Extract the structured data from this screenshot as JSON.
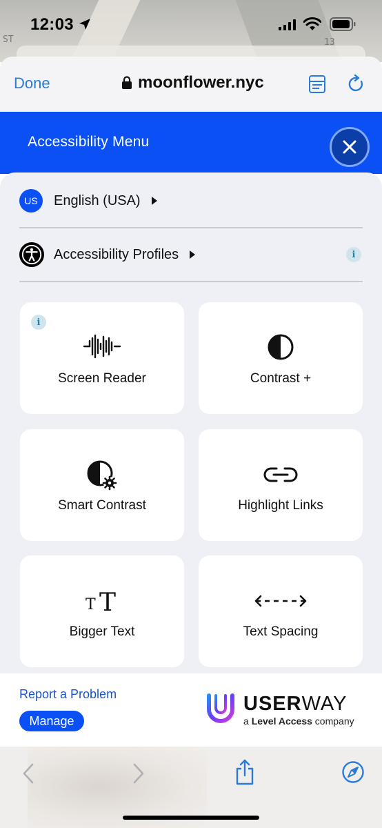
{
  "status_bar": {
    "time": "12:03"
  },
  "backdrop": {
    "tags": [
      "ST",
      "13"
    ]
  },
  "browser": {
    "done_label": "Done",
    "url": "moonflower.nyc"
  },
  "accessibility_menu": {
    "title": "Accessibility Menu",
    "language": {
      "badge": "US",
      "label": "English (USA)"
    },
    "profiles": {
      "label": "Accessibility Profiles",
      "info": "i"
    },
    "tiles": [
      {
        "label": "Screen Reader",
        "icon": "waveform-icon",
        "info": "i"
      },
      {
        "label": "Contrast +",
        "icon": "contrast-icon"
      },
      {
        "label": "Smart Contrast",
        "icon": "smart-contrast-icon"
      },
      {
        "label": "Highlight Links",
        "icon": "link-icon"
      },
      {
        "label": "Bigger Text",
        "icon": "text-size-icon",
        "icon_text": "TT"
      },
      {
        "label": "Text Spacing",
        "icon": "text-spacing-icon"
      }
    ]
  },
  "footer": {
    "report_label": "Report a Problem",
    "manage_label": "Manage",
    "brand_bold": "USER",
    "brand_light": "WAY",
    "tagline_prefix": "a ",
    "tagline_bold": "Level Access",
    "tagline_suffix": " company"
  },
  "colors": {
    "accent": "#0a50f5",
    "link": "#2a7bd9",
    "panel_bg": "#eef0f6"
  }
}
